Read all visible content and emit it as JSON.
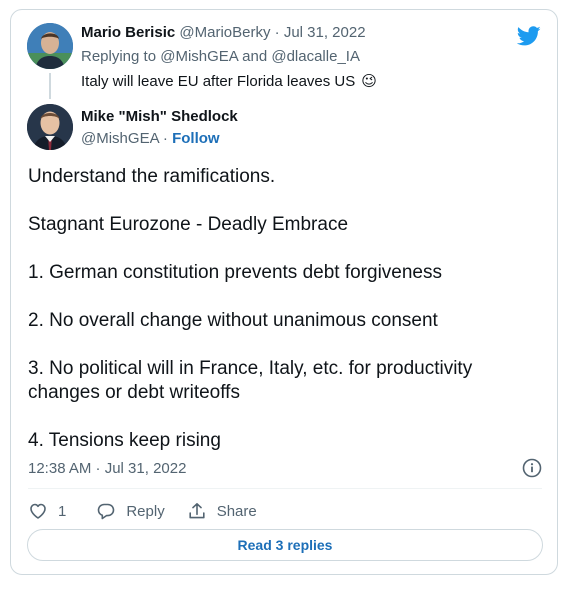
{
  "parent_tweet": {
    "author_name": "Mario Berisic",
    "author_handle": "@MarioBerky",
    "separator": " · ",
    "date": "Jul 31, 2022",
    "replying_prefix": "Replying to ",
    "replying_handle_1": "@MishGEA",
    "replying_and": " and ",
    "replying_handle_2": "@dlacalle_IA",
    "text": "Italy will leave EU after Florida leaves US",
    "emoji": "😉"
  },
  "main_tweet": {
    "author_name": "Mike \"Mish\" Shedlock",
    "author_handle": "@MishGEA",
    "separator": " · ",
    "follow_label": "Follow",
    "paragraphs": [
      "Understand the ramifications.",
      "Stagnant Eurozone - Deadly Embrace",
      "1. German constitution prevents debt forgiveness",
      "2. No overall change without unanimous consent",
      "3. No political will in France, Italy, etc. for productivity changes or debt writeoffs",
      "4. Tensions keep rising"
    ],
    "timestamp": "12:38 AM · Jul 31, 2022"
  },
  "actions": {
    "like_count": "1",
    "reply_label": "Reply",
    "share_label": "Share"
  },
  "read_replies_label": "Read 3 replies",
  "icons": {
    "logo": "twitter-bird-icon",
    "info": "info-icon",
    "like": "heart-icon",
    "reply": "speech-bubble-icon",
    "share": "share-upload-icon"
  },
  "colors": {
    "brand": "#1d9bf0",
    "link": "#1d6fb8",
    "muted": "#536471",
    "border": "#cfd9de"
  }
}
